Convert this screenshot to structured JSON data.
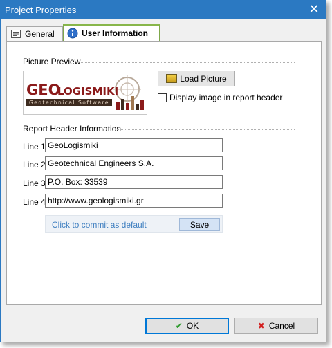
{
  "window": {
    "title": "Project Properties",
    "close_glyph": "✕"
  },
  "tabs": [
    {
      "label": "General",
      "icon": "document-icon",
      "selected": false
    },
    {
      "label": "User Information",
      "icon": "info-icon",
      "selected": true
    }
  ],
  "picture_preview": {
    "section_title": "Picture Preview",
    "logo_text_geo": "GEO",
    "logo_text_logismiki": "LOGISMIKI",
    "logo_subtitle": "Geotechnical Software",
    "load_button_label": "Load Picture",
    "display_in_header_label": "Display image in report header",
    "display_in_header_checked": false
  },
  "report_header": {
    "section_title": "Report Header Information",
    "lines": [
      {
        "label": "Line 1",
        "value": "GeoLogismiki"
      },
      {
        "label": "Line 2",
        "value": "Geotechnical Engineers S.A."
      },
      {
        "label": "Line 3",
        "value": "P.O. Box: 33539"
      },
      {
        "label": "Line 4",
        "value": "http://www.geologismiki.gr"
      }
    ],
    "commit_text": "Click to commit as default",
    "save_label": "Save"
  },
  "footer": {
    "ok_label": "OK",
    "cancel_label": "Cancel"
  },
  "colors": {
    "titlebar": "#2b79c2",
    "accent_tab": "#88b64a",
    "logo_red": "#8b1a1a",
    "logo_dark": "#3d2b1f",
    "link_blue": "#3f7fc0"
  }
}
